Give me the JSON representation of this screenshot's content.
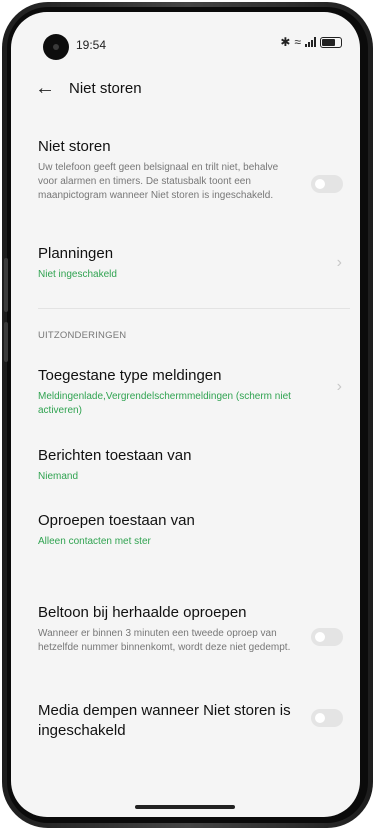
{
  "status_bar": {
    "time": "19:54",
    "bluetooth": "✱",
    "wifi": "≈"
  },
  "header": {
    "title": "Niet storen"
  },
  "dnd": {
    "title": "Niet storen",
    "description": "Uw telefoon geeft geen belsignaal en trilt niet, behalve voor alarmen en timers. De statusbalk toont een maanpictogram wanneer Niet storen is ingeschakeld.",
    "enabled": false
  },
  "schedules": {
    "title": "Planningen",
    "status": "Niet ingeschakeld"
  },
  "exceptions": {
    "section_label": "UITZONDERINGEN",
    "notification_types": {
      "title": "Toegestane type meldingen",
      "value": "Meldingenlade,Vergrendelschermmeldingen (scherm niet activeren)"
    },
    "messages": {
      "title": "Berichten toestaan van",
      "value": "Niemand"
    },
    "calls": {
      "title": "Oproepen toestaan van",
      "value": "Alleen contacten met ster"
    },
    "repeat_calls": {
      "title": "Beltoon bij herhaalde oproepen",
      "description": "Wanneer er binnen 3 minuten een tweede oproep van hetzelfde nummer binnenkomt, wordt deze niet gedempt.",
      "enabled": false
    },
    "mute_media": {
      "title": "Media dempen wanneer Niet storen is ingeschakeld",
      "enabled": false
    }
  },
  "colors": {
    "accent_green": "#30a351",
    "background": "#f5f5f5",
    "toggle_off": "#e4e4e4"
  }
}
